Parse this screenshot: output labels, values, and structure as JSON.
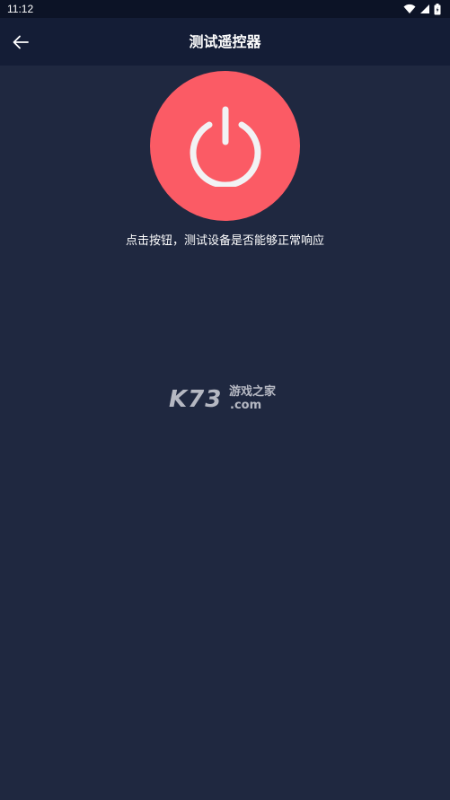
{
  "status_bar": {
    "time": "11:12",
    "icons": [
      "wifi-icon",
      "signal-icon",
      "battery-icon"
    ]
  },
  "header": {
    "title": "测试遥控器",
    "back_icon": "arrow-left-icon"
  },
  "main": {
    "power_icon": "power-icon",
    "power_color": "#fb5b65",
    "hint": "点击按钮，测试设备是否能够正常响应"
  },
  "watermark": {
    "brand": "K73",
    "name": "游戏之家",
    "domain": ".com"
  },
  "colors": {
    "background": "#1f2840",
    "app_bar": "#141d36",
    "status_bar": "#0c1326"
  }
}
